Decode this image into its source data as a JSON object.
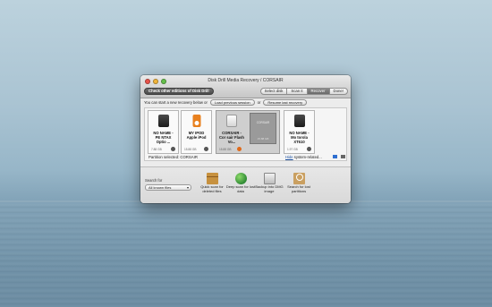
{
  "window": {
    "title": "Disk Drill Media Recovery  /  CORSAIR",
    "check_editions_label": "Check other editions of Disk Drill",
    "toolbar": {
      "select_disk": "Select disk",
      "scan_it": "Scan it",
      "recover": "Recover",
      "done": "Done!"
    }
  },
  "infobar": {
    "text": "You can start a new recovery below or",
    "load_session": "Load previous session",
    "or": "or",
    "resume": "Resume last recovery"
  },
  "disks": [
    {
      "name": "NO NAME - PE NTAX Optio ...",
      "size": "7.88 GB",
      "icon": "drive-icon"
    },
    {
      "name": "MY IPOD Apple iPod",
      "size": "15.88 GB",
      "icon": "ipod-icon"
    },
    {
      "name": "CORSAIR - Cor sair Flash Vo...",
      "size": "15.88 GB",
      "icon": "drive-icon"
    },
    {
      "name": "NO NAME - Mo torola XT610",
      "size": "1.97 GB",
      "icon": "drive-icon"
    }
  ],
  "partition": {
    "name": "CORSAIR",
    "size": "15.88 GB"
  },
  "partition_selected": "Partition selected: CORSAIR",
  "hide_system": {
    "link": "Hide",
    "text": " system-related..."
  },
  "bottom": {
    "search_for_label": "Search for",
    "search_for_value": "All known files",
    "actions": [
      {
        "label": "Quick scan for deleted files",
        "icon": "box-icon"
      },
      {
        "label": "Deep scan for lost data",
        "icon": "globe-icon"
      },
      {
        "label": "Backup into DMG image",
        "icon": "disk-image-icon"
      },
      {
        "label": "Search for lost partitions",
        "icon": "magnifier-icon"
      }
    ]
  }
}
